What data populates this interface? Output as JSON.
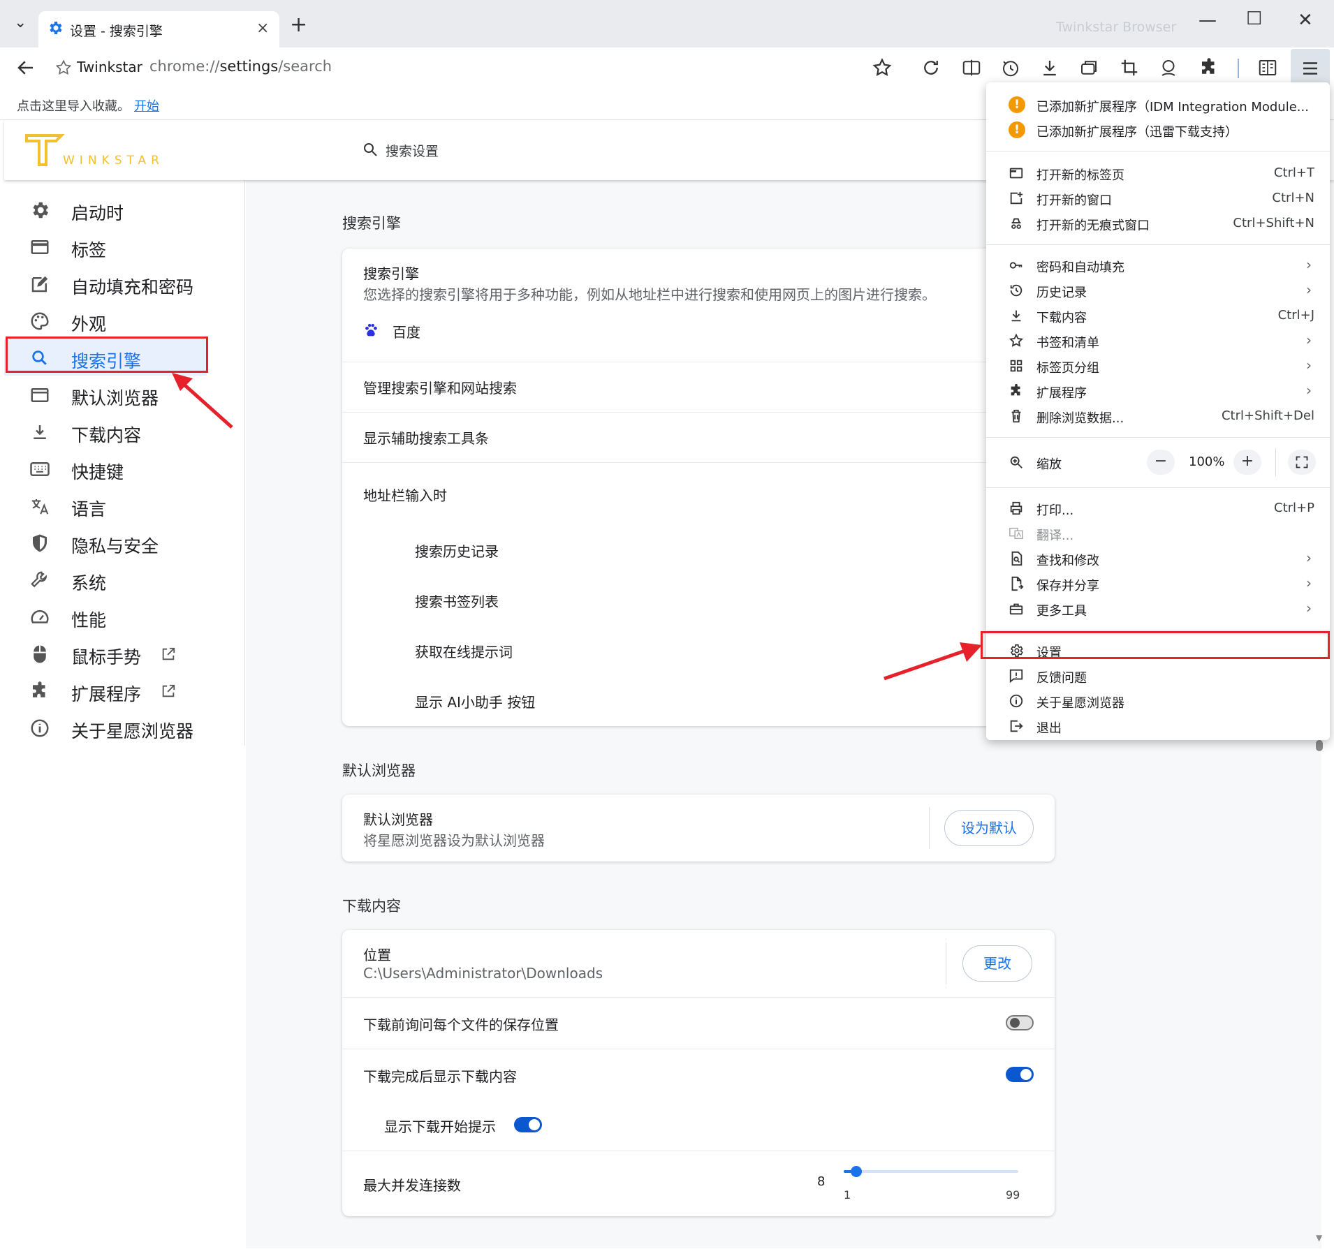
{
  "titlebar": {
    "tab_title": "设置 - 搜索引擎",
    "brand_faded": "Twinkstar Browser",
    "new_tab": "+",
    "tab_close": "×",
    "dropdown": "⌄",
    "minimize": "—",
    "maximize": "☐",
    "close": "✕"
  },
  "toolbar": {
    "site_name": "Twinkstar",
    "url_scheme": "chrome://",
    "url_host": "settings",
    "url_path": "/search",
    "icons": [
      "back-icon",
      "star-icon",
      "reload-icon",
      "split-view-icon",
      "history-icon",
      "download-icon",
      "tab-switch-icon",
      "crop-icon",
      "account-icon",
      "extensions-icon",
      "reading-list-icon",
      "menu-icon"
    ]
  },
  "bookmarks_bar": {
    "prompt": "点击这里导入收藏。",
    "link": "开始"
  },
  "header": {
    "logo_text": "WINKSTAR",
    "search_placeholder": "搜索设置"
  },
  "sidebar": {
    "items": [
      {
        "label": "启动时",
        "icon": "gear-icon"
      },
      {
        "label": "标签",
        "icon": "tab-icon"
      },
      {
        "label": "自动填充和密码",
        "icon": "edit-icon"
      },
      {
        "label": "外观",
        "icon": "palette-icon"
      },
      {
        "label": "搜索引擎",
        "icon": "search-icon",
        "active": true
      },
      {
        "label": "默认浏览器",
        "icon": "browser-icon"
      },
      {
        "label": "下载内容",
        "icon": "download-icon"
      },
      {
        "label": "快捷键",
        "icon": "keyboard-icon"
      },
      {
        "label": "语言",
        "icon": "translate-icon"
      },
      {
        "label": "隐私与安全",
        "icon": "shield-icon"
      },
      {
        "label": "系统",
        "icon": "wrench-icon"
      },
      {
        "label": "性能",
        "icon": "speedometer-icon"
      },
      {
        "label": "鼠标手势",
        "icon": "mouse-icon",
        "external": true
      },
      {
        "label": "扩展程序",
        "icon": "puzzle-icon",
        "external": true
      },
      {
        "label": "关于星愿浏览器",
        "icon": "info-icon"
      }
    ]
  },
  "search_engine": {
    "section_title": "搜索引擎",
    "card_title": "搜索引擎",
    "card_desc": "您选择的搜索引擎将用于多种功能，例如从地址栏中进行搜索和使用网页上的图片进行搜索。",
    "engine": "百度",
    "manage": "管理搜索引擎和网站搜索",
    "show_toolbar": "显示辅助搜索工具条",
    "omnibox_title": "地址栏输入时",
    "omnibox_options": [
      "搜索历史记录",
      "搜索书签列表",
      "获取在线提示词",
      "显示 AI小助手 按钮"
    ]
  },
  "default_browser": {
    "section_title": "默认浏览器",
    "title": "默认浏览器",
    "desc": "将星愿浏览器设为默认浏览器",
    "button": "设为默认"
  },
  "downloads": {
    "section_title": "下载内容",
    "location_label": "位置",
    "location_path": "C:\\Users\\Administrator\\Downloads",
    "change_button": "更改",
    "ask_where": "下载前询问每个文件的保存位置",
    "ask_where_on": false,
    "show_after": "下载完成后显示下载内容",
    "show_after_on": true,
    "show_start_hint": "显示下载开始提示",
    "show_start_hint_on": true,
    "max_connections": "最大并发连接数",
    "max_connections_value": "8",
    "slider_min": "1",
    "slider_max": "99",
    "slider_fraction": 0.07
  },
  "menu": {
    "notices": [
      "已添加新扩展程序（IDM Integration Module...",
      "已添加新扩展程序（迅雷下载支持）"
    ],
    "group1": [
      {
        "label": "打开新的标签页",
        "shortcut": "Ctrl+T",
        "icon": "new-tab-icon"
      },
      {
        "label": "打开新的窗口",
        "shortcut": "Ctrl+N",
        "icon": "new-window-icon"
      },
      {
        "label": "打开新的无痕式窗口",
        "shortcut": "Ctrl+Shift+N",
        "icon": "incognito-icon"
      }
    ],
    "group2": [
      {
        "label": "密码和自动填充",
        "arrow": "›",
        "icon": "key-icon"
      },
      {
        "label": "历史记录",
        "arrow": "›",
        "icon": "history-icon"
      },
      {
        "label": "下载内容",
        "shortcut": "Ctrl+J",
        "icon": "download-icon"
      },
      {
        "label": "书签和清单",
        "arrow": "›",
        "icon": "star-icon"
      },
      {
        "label": "标签页分组",
        "arrow": "›",
        "icon": "grid-icon"
      },
      {
        "label": "扩展程序",
        "arrow": "›",
        "icon": "puzzle-icon"
      },
      {
        "label": "删除浏览数据...",
        "shortcut": "Ctrl+Shift+Del",
        "icon": "trash-icon"
      }
    ],
    "zoom": {
      "label": "缩放",
      "value": "100%",
      "minus": "−",
      "plus": "+"
    },
    "group3": [
      {
        "label": "打印...",
        "shortcut": "Ctrl+P",
        "icon": "print-icon"
      },
      {
        "label": "翻译...",
        "icon": "translate-icon",
        "disabled": true
      },
      {
        "label": "查找和修改",
        "arrow": "›",
        "icon": "find-icon"
      },
      {
        "label": "保存并分享",
        "arrow": "›",
        "icon": "save-share-icon"
      },
      {
        "label": "更多工具",
        "arrow": "›",
        "icon": "toolbox-icon"
      }
    ],
    "group4": [
      {
        "label": "设置",
        "icon": "gear-icon"
      },
      {
        "label": "反馈问题",
        "icon": "feedback-icon"
      },
      {
        "label": "关于星愿浏览器",
        "icon": "info-icon"
      },
      {
        "label": "退出",
        "icon": "exit-icon"
      }
    ]
  },
  "colors": {
    "accent": "#1a73e8",
    "toggle_on": "#0b57d0",
    "annotation_red": "#e5222b",
    "warning": "#f29900",
    "logo_gold": "#f0c030"
  }
}
